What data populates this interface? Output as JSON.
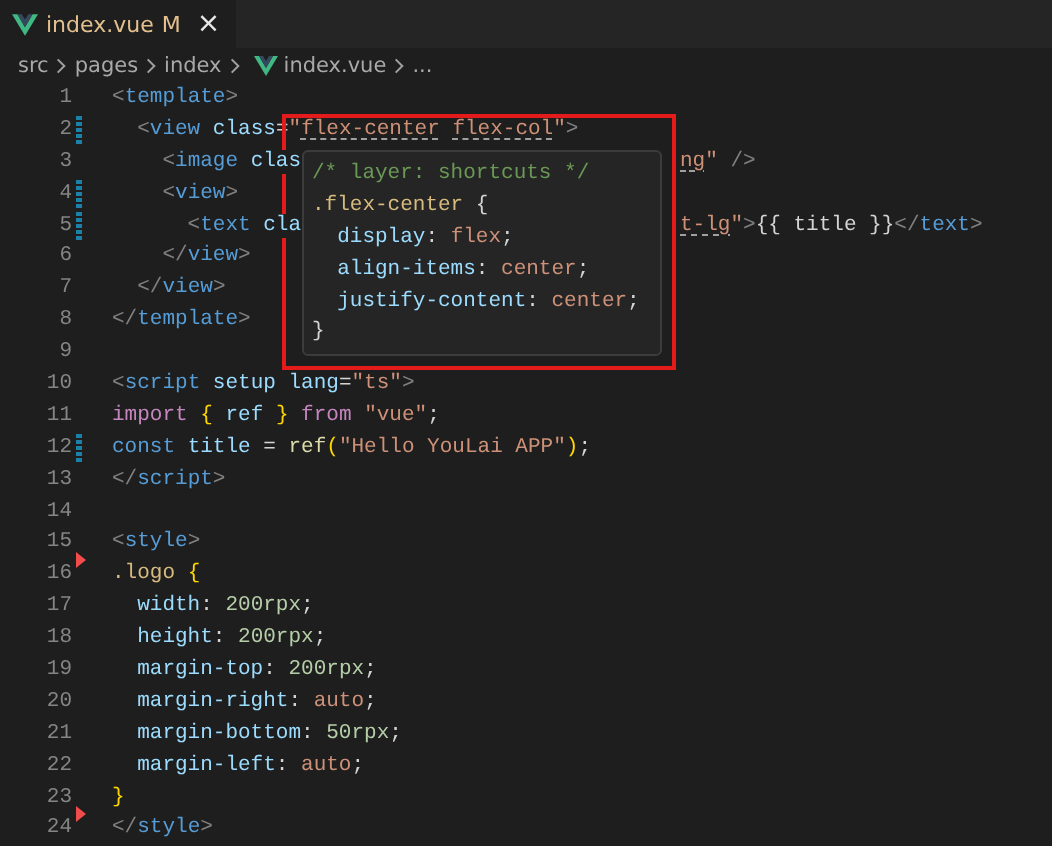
{
  "tabs": [
    {
      "label": "index.vue",
      "badge": "M",
      "close": "×",
      "selected": true
    }
  ],
  "breadcrumb": {
    "items": [
      {
        "label": "src",
        "kind": "folder"
      },
      {
        "label": "pages",
        "kind": "folder"
      },
      {
        "label": "index",
        "kind": "folder"
      },
      {
        "label": "index.vue",
        "kind": "file"
      }
    ],
    "more": "..."
  },
  "lines": [
    {
      "number": "1",
      "tokens": [
        {
          "kind": "punct",
          "text": "<"
        },
        {
          "kind": "tag",
          "text": "template"
        },
        {
          "kind": "punct",
          "text": ">"
        }
      ]
    },
    {
      "number": "2",
      "modified": true,
      "tokens": [
        {
          "kind": "punct",
          "text": "  <"
        },
        {
          "kind": "tag",
          "text": "view"
        },
        {
          "kind": "attr",
          "text": " class"
        },
        {
          "kind": "plain",
          "text": "="
        },
        {
          "kind": "string",
          "text": "\""
        },
        {
          "kind": "string",
          "text": "flex-center",
          "underlined": true
        },
        {
          "kind": "string",
          "text": " flex-col",
          "underlined": true
        },
        {
          "kind": "string",
          "text": "\""
        },
        {
          "kind": "punct",
          "text": ">"
        }
      ]
    },
    {
      "number": "3",
      "tokens": [
        {
          "kind": "punct",
          "text": "    <"
        },
        {
          "kind": "tag",
          "text": "image"
        },
        {
          "kind": "attr",
          "text": " clas"
        }
      ],
      "tail": [
        {
          "kind": "string",
          "text": "ng",
          "underlined": true
        },
        {
          "kind": "string",
          "text": "\""
        },
        {
          "kind": "punct",
          "text": " />"
        }
      ]
    },
    {
      "number": "4",
      "modified": true,
      "tokens": [
        {
          "kind": "punct",
          "text": "    <"
        },
        {
          "kind": "tag",
          "text": "view"
        },
        {
          "kind": "punct",
          "text": ">"
        }
      ]
    },
    {
      "number": "5",
      "modified": true,
      "tokens": [
        {
          "kind": "punct",
          "text": "      <"
        },
        {
          "kind": "tag",
          "text": "text"
        },
        {
          "kind": "attr",
          "text": " cla"
        }
      ],
      "tail": [
        {
          "kind": "string",
          "text": "t-lg",
          "underlined": true
        },
        {
          "kind": "string",
          "text": "\""
        },
        {
          "kind": "punct",
          "text": ">"
        },
        {
          "kind": "plain",
          "text": "{{ title }}"
        },
        {
          "kind": "punct",
          "text": "</"
        },
        {
          "kind": "tag",
          "text": "text"
        },
        {
          "kind": "punct",
          "text": ">"
        }
      ]
    },
    {
      "number": "6",
      "tokens": [
        {
          "kind": "punct",
          "text": "    </"
        },
        {
          "kind": "tag",
          "text": "view"
        },
        {
          "kind": "punct",
          "text": ">"
        }
      ]
    },
    {
      "number": "7",
      "tokens": [
        {
          "kind": "punct",
          "text": "  </"
        },
        {
          "kind": "tag",
          "text": "view"
        },
        {
          "kind": "punct",
          "text": ">"
        }
      ]
    },
    {
      "number": "8",
      "tokens": [
        {
          "kind": "punct",
          "text": "</"
        },
        {
          "kind": "tag",
          "text": "template"
        },
        {
          "kind": "punct",
          "text": ">"
        }
      ]
    },
    {
      "number": "9"
    },
    {
      "number": "10",
      "tokens": [
        {
          "kind": "punct",
          "text": "<"
        },
        {
          "kind": "tag",
          "text": "script"
        },
        {
          "kind": "attr",
          "text": " setup lang"
        },
        {
          "kind": "plain",
          "text": "="
        },
        {
          "kind": "string",
          "text": "\"ts\""
        },
        {
          "kind": "punct",
          "text": ">"
        }
      ]
    },
    {
      "number": "11",
      "tokens": [
        {
          "kind": "keyword",
          "text": "import"
        },
        {
          "kind": "brace",
          "text": " {"
        },
        {
          "kind": "variable",
          "text": " ref "
        },
        {
          "kind": "brace",
          "text": "}"
        },
        {
          "kind": "keyword",
          "text": " from"
        },
        {
          "kind": "string",
          "text": " \"vue\""
        },
        {
          "kind": "plain",
          "text": ";"
        }
      ]
    },
    {
      "number": "12",
      "modified": true,
      "tokens": [
        {
          "kind": "tag",
          "text": "const"
        },
        {
          "kind": "variable",
          "text": " title"
        },
        {
          "kind": "plain",
          "text": " = "
        },
        {
          "kind": "function",
          "text": "ref"
        },
        {
          "kind": "brace",
          "text": "("
        },
        {
          "kind": "string",
          "text": "\"Hello YouLai APP\""
        },
        {
          "kind": "brace",
          "text": ")"
        },
        {
          "kind": "plain",
          "text": ";"
        }
      ]
    },
    {
      "number": "13",
      "tokens": [
        {
          "kind": "punct",
          "text": "</"
        },
        {
          "kind": "tag",
          "text": "script"
        },
        {
          "kind": "punct",
          "text": ">"
        }
      ]
    },
    {
      "number": "14"
    },
    {
      "number": "15",
      "tokens": [
        {
          "kind": "punct",
          "text": "<"
        },
        {
          "kind": "tag",
          "text": "style"
        },
        {
          "kind": "punct",
          "text": ">"
        }
      ]
    },
    {
      "number": "16",
      "deletion_above": true,
      "tokens": [
        {
          "kind": "selector",
          "text": ".logo"
        },
        {
          "kind": "brace",
          "text": " {"
        }
      ]
    },
    {
      "number": "17",
      "tokens": [
        {
          "kind": "property",
          "text": "  width"
        },
        {
          "kind": "plain",
          "text": ": "
        },
        {
          "kind": "number",
          "text": "200rpx"
        },
        {
          "kind": "plain",
          "text": ";"
        }
      ]
    },
    {
      "number": "18",
      "tokens": [
        {
          "kind": "property",
          "text": "  height"
        },
        {
          "kind": "plain",
          "text": ": "
        },
        {
          "kind": "number",
          "text": "200rpx"
        },
        {
          "kind": "plain",
          "text": ";"
        }
      ]
    },
    {
      "number": "19",
      "tokens": [
        {
          "kind": "property",
          "text": "  margin-top"
        },
        {
          "kind": "plain",
          "text": ": "
        },
        {
          "kind": "number",
          "text": "200rpx"
        },
        {
          "kind": "plain",
          "text": ";"
        }
      ]
    },
    {
      "number": "20",
      "tokens": [
        {
          "kind": "property",
          "text": "  margin-right"
        },
        {
          "kind": "plain",
          "text": ": "
        },
        {
          "kind": "value",
          "text": "auto"
        },
        {
          "kind": "plain",
          "text": ";"
        }
      ]
    },
    {
      "number": "21",
      "tokens": [
        {
          "kind": "property",
          "text": "  margin-bottom"
        },
        {
          "kind": "plain",
          "text": ": "
        },
        {
          "kind": "number",
          "text": "50rpx"
        },
        {
          "kind": "plain",
          "text": ";"
        }
      ]
    },
    {
      "number": "22",
      "tokens": [
        {
          "kind": "property",
          "text": "  margin-left"
        },
        {
          "kind": "plain",
          "text": ": "
        },
        {
          "kind": "value",
          "text": "auto"
        },
        {
          "kind": "plain",
          "text": ";"
        }
      ]
    },
    {
      "number": "23",
      "tokens": [
        {
          "kind": "brace",
          "text": "}"
        }
      ]
    },
    {
      "number": "24",
      "deletion_above": true,
      "tokens": [
        {
          "kind": "punct",
          "text": "</"
        },
        {
          "kind": "tag",
          "text": "style"
        },
        {
          "kind": "punct",
          "text": ">"
        }
      ]
    }
  ],
  "hover": {
    "lines": [
      [
        {
          "kind": "comment",
          "text": "/* layer: shortcuts */"
        }
      ],
      [
        {
          "kind": "selector",
          "text": ".flex-center"
        },
        {
          "kind": "plain",
          "text": " {"
        }
      ],
      [
        {
          "kind": "property",
          "text": "  display"
        },
        {
          "kind": "plain",
          "text": ": "
        },
        {
          "kind": "value",
          "text": "flex"
        },
        {
          "kind": "plain",
          "text": ";"
        }
      ],
      [
        {
          "kind": "property",
          "text": "  align-items"
        },
        {
          "kind": "plain",
          "text": ": "
        },
        {
          "kind": "value",
          "text": "center"
        },
        {
          "kind": "plain",
          "text": ";"
        }
      ],
      [
        {
          "kind": "property",
          "text": "  justify-content"
        },
        {
          "kind": "plain",
          "text": ": "
        },
        {
          "kind": "value",
          "text": "center"
        },
        {
          "kind": "plain",
          "text": ";"
        }
      ],
      [
        {
          "kind": "plain",
          "text": "}"
        }
      ]
    ]
  }
}
